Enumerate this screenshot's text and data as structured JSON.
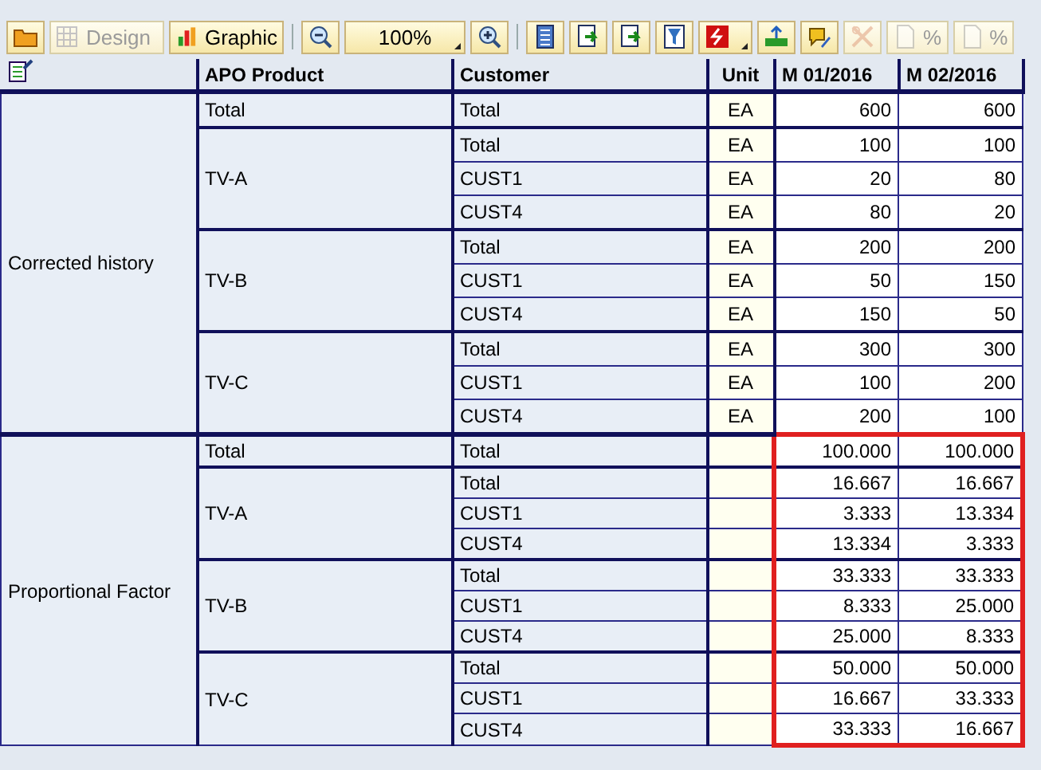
{
  "toolbar": [
    {
      "kind": "icon",
      "disabled": false
    },
    {
      "kind": "button",
      "label": "Design",
      "disabled": true
    },
    {
      "kind": "button",
      "label": "Graphic",
      "disabled": false
    },
    {
      "kind": "separator"
    },
    {
      "kind": "icon",
      "disabled": false
    },
    {
      "kind": "dropdown",
      "label": "100%",
      "disabled": false
    },
    {
      "kind": "icon",
      "disabled": false
    },
    {
      "kind": "separator"
    },
    {
      "kind": "icon",
      "disabled": false
    },
    {
      "kind": "icon",
      "disabled": false
    },
    {
      "kind": "icon",
      "disabled": false
    },
    {
      "kind": "icon",
      "disabled": false
    },
    {
      "kind": "icon-dropdown",
      "disabled": false
    },
    {
      "kind": "icon",
      "disabled": false
    },
    {
      "kind": "icon",
      "disabled": false
    },
    {
      "kind": "icon",
      "disabled": true
    },
    {
      "kind": "button",
      "label": "%",
      "disabled": true
    },
    {
      "kind": "button",
      "label": "%",
      "disabled": true
    }
  ],
  "table": {
    "columns": [
      "APO Product",
      "Customer",
      "Unit",
      "M 01/2016",
      "M 02/2016"
    ],
    "key_figures": [
      {
        "name": "Corrected history",
        "highlighted": false,
        "products": [
          {
            "name": "Total",
            "rows": [
              {
                "customer": "Total",
                "unit": "EA",
                "values": [
                  "600",
                  "600"
                ]
              }
            ]
          },
          {
            "name": "TV-A",
            "rows": [
              {
                "customer": "Total",
                "unit": "EA",
                "values": [
                  "100",
                  "100"
                ]
              },
              {
                "customer": "CUST1",
                "unit": "EA",
                "values": [
                  "20",
                  "80"
                ]
              },
              {
                "customer": "CUST4",
                "unit": "EA",
                "values": [
                  "80",
                  "20"
                ]
              }
            ]
          },
          {
            "name": "TV-B",
            "rows": [
              {
                "customer": "Total",
                "unit": "EA",
                "values": [
                  "200",
                  "200"
                ]
              },
              {
                "customer": "CUST1",
                "unit": "EA",
                "values": [
                  "50",
                  "150"
                ]
              },
              {
                "customer": "CUST4",
                "unit": "EA",
                "values": [
                  "150",
                  "50"
                ]
              }
            ]
          },
          {
            "name": "TV-C",
            "rows": [
              {
                "customer": "Total",
                "unit": "EA",
                "values": [
                  "300",
                  "300"
                ]
              },
              {
                "customer": "CUST1",
                "unit": "EA",
                "values": [
                  "100",
                  "200"
                ]
              },
              {
                "customer": "CUST4",
                "unit": "EA",
                "values": [
                  "200",
                  "100"
                ]
              }
            ]
          }
        ]
      },
      {
        "name": "Proportional Factor",
        "highlighted": true,
        "products": [
          {
            "name": "Total",
            "rows": [
              {
                "customer": "Total",
                "values": [
                  "100.000",
                  "100.000"
                ]
              }
            ]
          },
          {
            "name": "TV-A",
            "rows": [
              {
                "customer": "Total",
                "values": [
                  "16.667",
                  "16.667"
                ]
              },
              {
                "customer": "CUST1",
                "values": [
                  "3.333",
                  "13.334"
                ]
              },
              {
                "customer": "CUST4",
                "values": [
                  "13.334",
                  "3.333"
                ]
              }
            ]
          },
          {
            "name": "TV-B",
            "rows": [
              {
                "customer": "Total",
                "values": [
                  "33.333",
                  "33.333"
                ]
              },
              {
                "customer": "CUST1",
                "values": [
                  "8.333",
                  "25.000"
                ]
              },
              {
                "customer": "CUST4",
                "values": [
                  "25.000",
                  "8.333"
                ]
              }
            ]
          },
          {
            "name": "TV-C",
            "rows": [
              {
                "customer": "Total",
                "values": [
                  "50.000",
                  "50.000"
                ]
              },
              {
                "customer": "CUST1",
                "values": [
                  "16.667",
                  "33.333"
                ]
              },
              {
                "customer": "CUST4",
                "values": [
                  "33.333",
                  "16.667"
                ]
              }
            ]
          }
        ]
      }
    ]
  }
}
